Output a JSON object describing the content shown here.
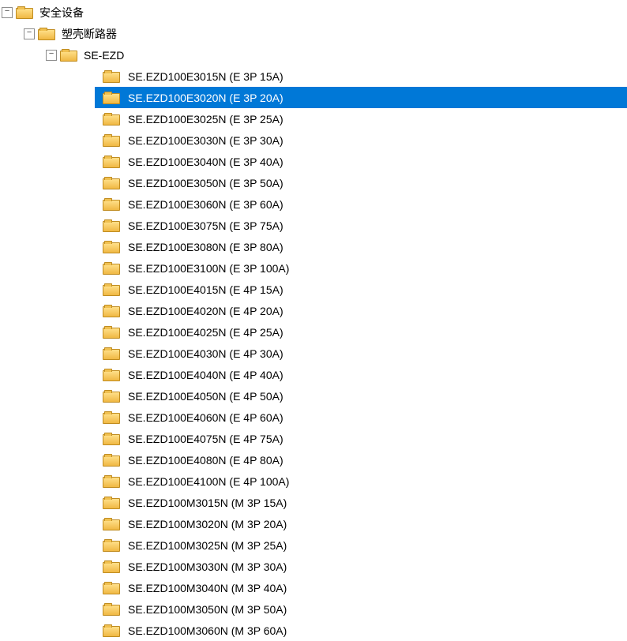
{
  "tree": {
    "root": {
      "label": "安全设备",
      "expanded": true,
      "children": [
        {
          "label": "塑壳断路器",
          "expanded": true,
          "children": [
            {
              "label": "SE-EZD",
              "expanded": true,
              "items": [
                {
                  "label": "SE.EZD100E3015N (E 3P 15A)",
                  "selected": false
                },
                {
                  "label": "SE.EZD100E3020N (E 3P 20A)",
                  "selected": true
                },
                {
                  "label": "SE.EZD100E3025N (E 3P 25A)",
                  "selected": false
                },
                {
                  "label": "SE.EZD100E3030N (E 3P 30A)",
                  "selected": false
                },
                {
                  "label": "SE.EZD100E3040N (E 3P 40A)",
                  "selected": false
                },
                {
                  "label": "SE.EZD100E3050N (E 3P 50A)",
                  "selected": false
                },
                {
                  "label": "SE.EZD100E3060N (E 3P 60A)",
                  "selected": false
                },
                {
                  "label": "SE.EZD100E3075N (E 3P 75A)",
                  "selected": false
                },
                {
                  "label": "SE.EZD100E3080N (E 3P 80A)",
                  "selected": false
                },
                {
                  "label": "SE.EZD100E3100N (E 3P 100A)",
                  "selected": false
                },
                {
                  "label": "SE.EZD100E4015N (E 4P 15A)",
                  "selected": false
                },
                {
                  "label": "SE.EZD100E4020N (E 4P 20A)",
                  "selected": false
                },
                {
                  "label": "SE.EZD100E4025N (E 4P 25A)",
                  "selected": false
                },
                {
                  "label": "SE.EZD100E4030N (E 4P 30A)",
                  "selected": false
                },
                {
                  "label": "SE.EZD100E4040N (E 4P 40A)",
                  "selected": false
                },
                {
                  "label": "SE.EZD100E4050N (E 4P 50A)",
                  "selected": false
                },
                {
                  "label": "SE.EZD100E4060N (E 4P 60A)",
                  "selected": false
                },
                {
                  "label": "SE.EZD100E4075N (E 4P 75A)",
                  "selected": false
                },
                {
                  "label": "SE.EZD100E4080N (E 4P 80A)",
                  "selected": false
                },
                {
                  "label": "SE.EZD100E4100N (E 4P 100A)",
                  "selected": false
                },
                {
                  "label": "SE.EZD100M3015N (M 3P 15A)",
                  "selected": false
                },
                {
                  "label": "SE.EZD100M3020N (M 3P 20A)",
                  "selected": false
                },
                {
                  "label": "SE.EZD100M3025N (M 3P 25A)",
                  "selected": false
                },
                {
                  "label": "SE.EZD100M3030N (M 3P 30A)",
                  "selected": false
                },
                {
                  "label": "SE.EZD100M3040N (M 3P 40A)",
                  "selected": false
                },
                {
                  "label": "SE.EZD100M3050N (M 3P 50A)",
                  "selected": false
                },
                {
                  "label": "SE.EZD100M3060N (M 3P 60A)",
                  "selected": false
                }
              ]
            }
          ]
        }
      ]
    },
    "toggle_collapse_glyph": "−",
    "toggle_expand_glyph": "+"
  }
}
